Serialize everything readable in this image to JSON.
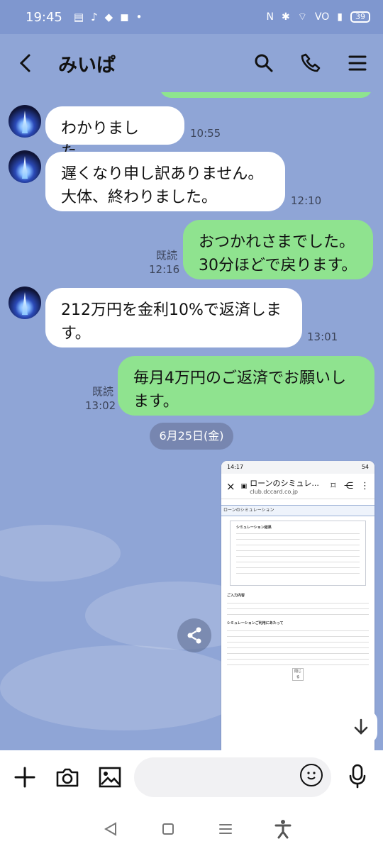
{
  "status_bar": {
    "time": "19:45",
    "battery": "39"
  },
  "header": {
    "title": "みいぱ"
  },
  "messages": [
    {
      "type": "incoming",
      "text": "わかりました。",
      "time": "10:55"
    },
    {
      "type": "incoming",
      "text": "遅くなり申し訳ありません。\n大体、終わりました。",
      "time": "12:10"
    },
    {
      "type": "outgoing",
      "text": "おつかれさまでした。\n30分ほどで戻ります。",
      "status": "既読",
      "time": "12:16"
    },
    {
      "type": "incoming",
      "text": "212万円を金利10%で返済しま\nす。",
      "time": "13:01"
    },
    {
      "type": "outgoing",
      "text": "毎月4万円のご返済でお願いし\nます。",
      "status": "既読",
      "time": "13:02"
    }
  ],
  "date_separator": "6月25日(金)",
  "screenshot_preview": {
    "time": "14:17",
    "status_badge": "54",
    "browser_title": "ローンのシミュレ...",
    "browser_url": "club.dccard.co.jp",
    "section_title": "ローンのシミュレーション",
    "result_title": "シミュレーション結果",
    "input_title": "ご入力内容",
    "notes_title": "シミュレーションご利用にあたって",
    "close_label": "閉じる"
  },
  "composer": {
    "placeholder": ""
  },
  "colors": {
    "chat_background": "#8fa5d6",
    "incoming_bubble": "#ffffff",
    "outgoing_bubble": "#8fe38f",
    "status_bar": "#7f97cf"
  }
}
